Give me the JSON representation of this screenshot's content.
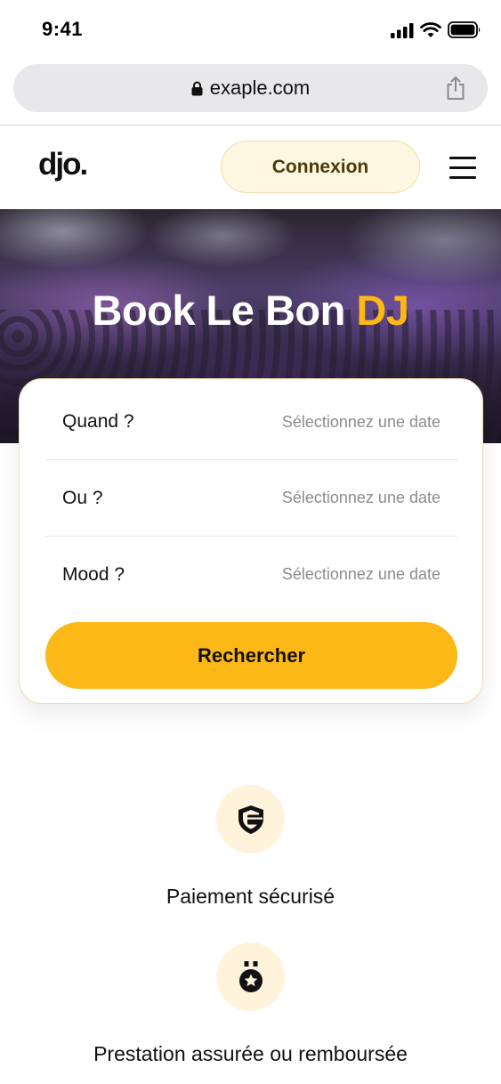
{
  "status_bar": {
    "time": "9:41"
  },
  "browser": {
    "url": "exaple.com"
  },
  "header": {
    "logo": "djo.",
    "login_label": "Connexion"
  },
  "hero": {
    "title_main": "Book Le Bon",
    "title_accent": "DJ"
  },
  "search": {
    "fields": [
      {
        "label": "Quand ?",
        "placeholder": "Sélectionnez une date"
      },
      {
        "label": "Ou ?",
        "placeholder": "Sélectionnez une date"
      },
      {
        "label": "Mood ?",
        "placeholder": "Sélectionnez une date"
      }
    ],
    "button_label": "Rechercher"
  },
  "features": [
    {
      "icon": "secure-payment-icon",
      "label": "Paiement sécurisé"
    },
    {
      "icon": "medal-icon",
      "label": "Prestation assurée ou remboursée"
    }
  ],
  "colors": {
    "accent": "#fbb816",
    "soft_accent": "#fff6e1",
    "icon_bg": "#fff3dc"
  }
}
